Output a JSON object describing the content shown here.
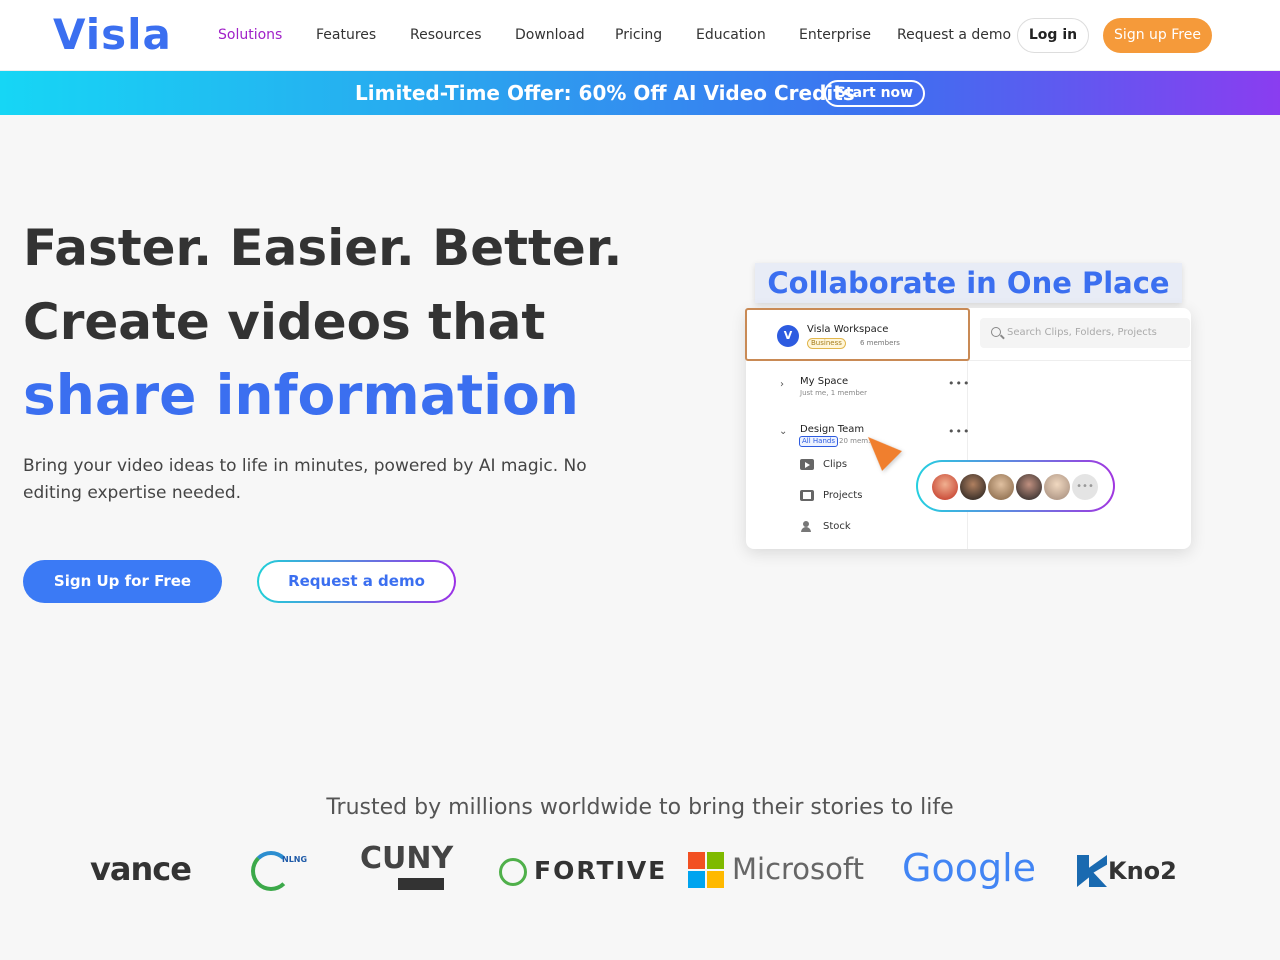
{
  "nav": {
    "logo": "Visla",
    "items": [
      "Solutions",
      "Features",
      "Resources",
      "Download",
      "Pricing",
      "Education",
      "Enterprise",
      "Request a demo"
    ],
    "login": "Log in",
    "signup": "Sign up Free",
    "active_item": "Solutions",
    "accent_color": "#a020c8"
  },
  "banner": {
    "text": "Limited-Time Offer: 60% Off AI Video Credits",
    "button": "Start now"
  },
  "hero": {
    "line1": "Faster. Easier. Better.",
    "line2": "Create videos that",
    "line3": "share information",
    "subtitle": "Bring your video ideas to life in minutes, powered by AI magic. No editing expertise needed.",
    "primary_button": "Sign Up for Free",
    "secondary_button": "Request a demo",
    "brand_color": "#3b6ff0"
  },
  "mockup": {
    "title": "Collaborate in One Place",
    "workspace_name": "Visla Workspace",
    "workspace_badge": "Business",
    "workspace_members": "6 members",
    "search_placeholder": "Search Clips, Folders, Projects",
    "my_space": "My Space",
    "my_space_sub": "Just me, 1 member",
    "design_team": "Design Team",
    "design_team_tag": "All Hands",
    "design_team_sub": "20 mem...",
    "sub_items": [
      "Clips",
      "Projects",
      "Stock"
    ],
    "more_label": "•••"
  },
  "trust": {
    "heading": "Trusted by millions worldwide to bring their stories to life",
    "logos": [
      "vance",
      "NLNG",
      "CUNY",
      "FORTIVE",
      "Microsoft",
      "Google",
      "Kno2"
    ]
  }
}
